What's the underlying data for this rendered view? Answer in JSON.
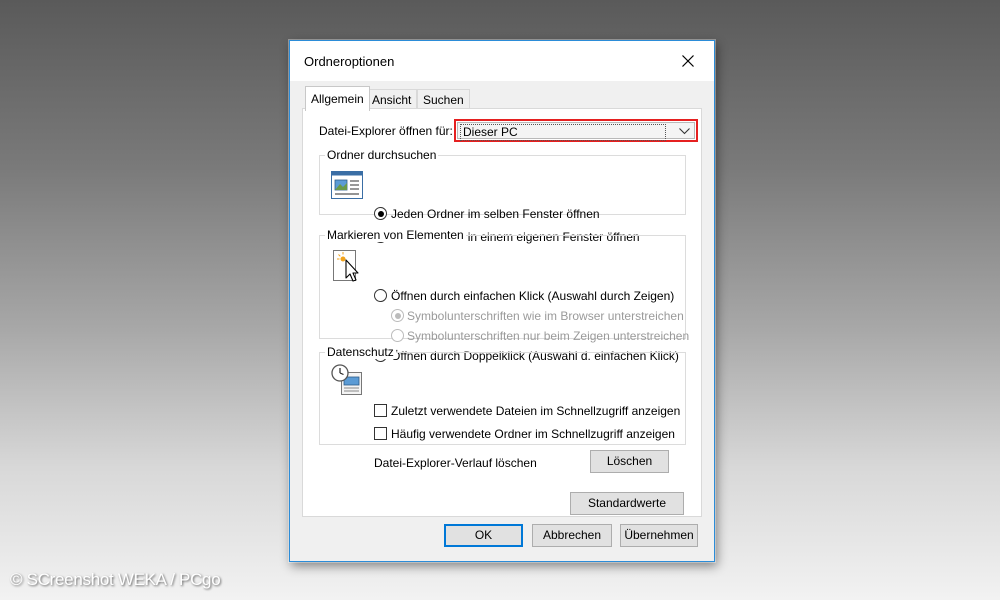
{
  "dialog": {
    "title": "Ordneroptionen",
    "tabs": [
      {
        "label": "Allgemein",
        "active": true
      },
      {
        "label": "Ansicht",
        "active": false
      },
      {
        "label": "Suchen",
        "active": false
      }
    ]
  },
  "general": {
    "open_label": "Datei-Explorer öffnen für:",
    "open_value": "Dieser PC",
    "browse_group": {
      "legend": "Ordner durchsuchen",
      "options": [
        {
          "label": "Jeden Ordner im selben Fenster öffnen",
          "selected": true
        },
        {
          "label": "Jeden Ordner in einem eigenen Fenster öffnen",
          "selected": false
        }
      ]
    },
    "click_group": {
      "legend": "Markieren von Elementen",
      "single_click": "Öffnen durch einfachen Klick (Auswahl durch Zeigen)",
      "sub_browser": "Symbolunterschriften wie im Browser unterstreichen",
      "sub_hover": "Symbolunterschriften nur beim Zeigen unterstreichen",
      "double_click": "Öffnen durch Doppelklick (Auswahl d. einfachen Klick)"
    },
    "privacy_group": {
      "legend": "Datenschutz",
      "recent_files": "Zuletzt verwendete Dateien im Schnellzugriff anzeigen",
      "frequent_folders": "Häufig verwendete Ordner im Schnellzugriff anzeigen",
      "clear_label": "Datei-Explorer-Verlauf löschen",
      "clear_button": "Löschen"
    },
    "defaults_button": "Standardwerte"
  },
  "footer": {
    "ok": "OK",
    "cancel": "Abbrechen",
    "apply": "Übernehmen"
  },
  "watermark": "© SCreenshot WEKA / PCgo",
  "colors": {
    "accent": "#0078d7",
    "highlight": "#e52020"
  }
}
